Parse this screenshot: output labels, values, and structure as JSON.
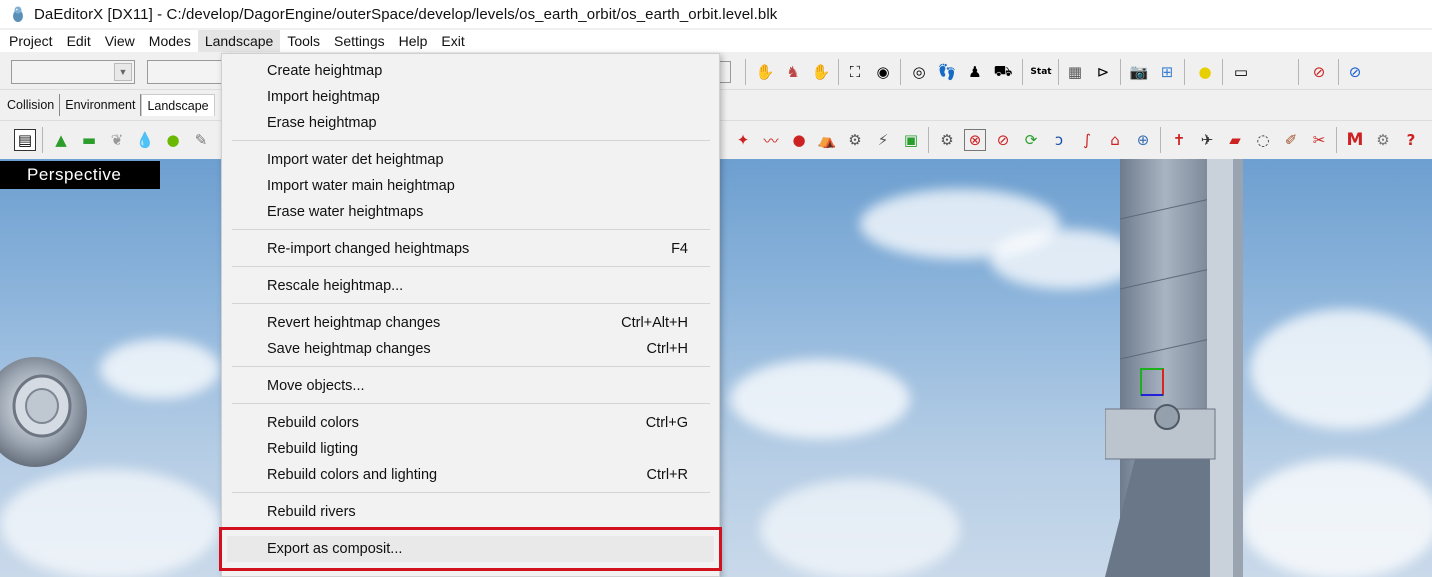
{
  "window": {
    "title": "DaEditorX  [DX11]  - C:/develop/DagorEngine/outerSpace/develop/levels/os_earth_orbit/os_earth_orbit.level.blk"
  },
  "menubar": {
    "items": [
      "Project",
      "Edit",
      "View",
      "Modes",
      "Landscape",
      "Tools",
      "Settings",
      "Help",
      "Exit"
    ]
  },
  "tabs": [
    "Collision",
    "Environment",
    "Landscape"
  ],
  "viewport": {
    "label": "Perspective"
  },
  "landscape_menu": {
    "items": [
      {
        "label": "Create heightmap",
        "shortcut": ""
      },
      {
        "label": "Import heightmap",
        "shortcut": ""
      },
      {
        "label": "Erase heightmap",
        "shortcut": ""
      },
      {
        "label": "Import water det heightmap",
        "shortcut": ""
      },
      {
        "label": "Import water main heightmap",
        "shortcut": ""
      },
      {
        "label": "Erase water heightmaps",
        "shortcut": ""
      },
      {
        "label": "Re-import changed heightmaps",
        "shortcut": "F4"
      },
      {
        "label": "Rescale heightmap...",
        "shortcut": ""
      },
      {
        "label": "Revert heightmap changes",
        "shortcut": "Ctrl+Alt+H"
      },
      {
        "label": "Save heightmap changes",
        "shortcut": "Ctrl+H"
      },
      {
        "label": "Move objects...",
        "shortcut": ""
      },
      {
        "label": "Rebuild colors",
        "shortcut": "Ctrl+G"
      },
      {
        "label": "Rebuild ligting",
        "shortcut": ""
      },
      {
        "label": "Rebuild colors and lighting",
        "shortcut": "Ctrl+R"
      },
      {
        "label": "Rebuild rivers",
        "shortcut": ""
      },
      {
        "label": "Export as composit...",
        "shortcut": ""
      }
    ],
    "highlighted_item": "Export as composit..."
  },
  "colors": {
    "highlight_box": "#d1121e",
    "menu_bg": "#f2f2f2"
  },
  "icons": {
    "app": "daeditor-icon",
    "toolbar": [
      "save-icon",
      "terrain-icon",
      "terrain-flat-icon",
      "wing-icon",
      "drop-icon",
      "paint-icon",
      "brush-icon",
      "camera-icon",
      "grid-icon",
      "sun-icon",
      "help-icon"
    ]
  }
}
